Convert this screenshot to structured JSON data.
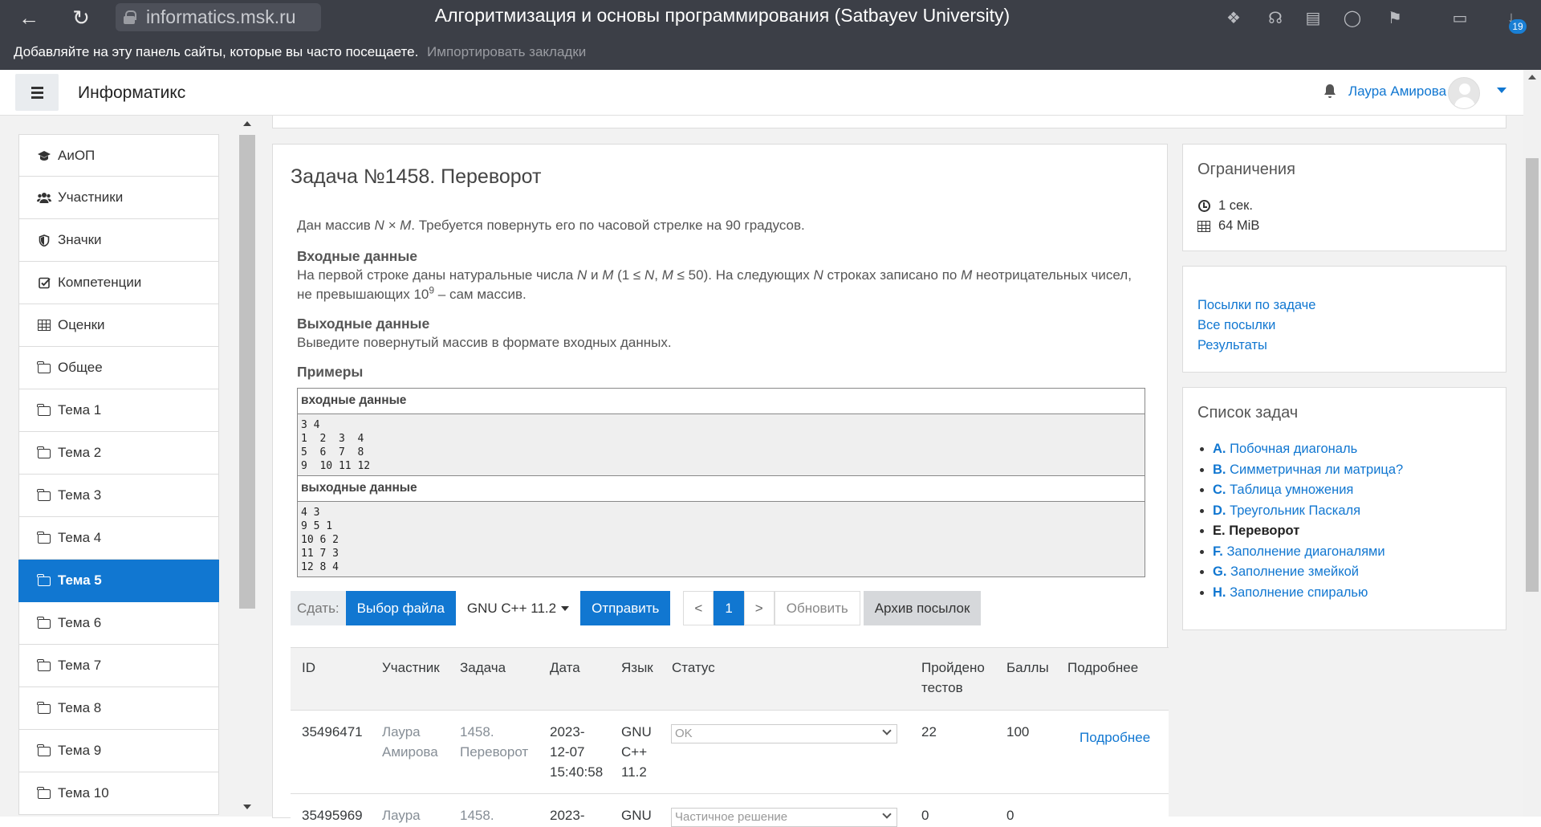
{
  "browser": {
    "url": "informatics.msk.ru",
    "page_title": "Алгоритмизация и основы программирования (Satbayev University)",
    "bookmarks_hint": "Добавляйте на эту панель сайты, которые вы часто посещаете.",
    "import_bookmarks": "Импортировать закладки",
    "downloads_badge": "19"
  },
  "navbar": {
    "brand": "Информатикс",
    "user_name": "Лаура Амирова"
  },
  "drawer": {
    "items": [
      {
        "label": "АиОП",
        "icon": "graduation-cap-icon"
      },
      {
        "label": "Участники",
        "icon": "users-icon"
      },
      {
        "label": "Значки",
        "icon": "shield-icon"
      },
      {
        "label": "Компетенции",
        "icon": "check-square-icon"
      },
      {
        "label": "Оценки",
        "icon": "table-icon"
      },
      {
        "label": "Общее",
        "icon": "folder-icon"
      },
      {
        "label": "Тема 1",
        "icon": "folder-icon"
      },
      {
        "label": "Тема 2",
        "icon": "folder-icon"
      },
      {
        "label": "Тема 3",
        "icon": "folder-icon"
      },
      {
        "label": "Тема 4",
        "icon": "folder-icon"
      },
      {
        "label": "Тема 5",
        "icon": "folder-icon",
        "active": true
      },
      {
        "label": "Тема 6",
        "icon": "folder-icon"
      },
      {
        "label": "Тема 7",
        "icon": "folder-icon"
      },
      {
        "label": "Тема 8",
        "icon": "folder-icon"
      },
      {
        "label": "Тема 9",
        "icon": "folder-icon"
      },
      {
        "label": "Тема 10",
        "icon": "folder-icon"
      }
    ]
  },
  "problem": {
    "title": "Задача №1458. Переворот",
    "statement_pre": "Дан массив ",
    "statement_math": "N × M",
    "statement_post": ". Требуется повернуть его по часовой стрелке на 90 градусов.",
    "input_heading": "Входные данные",
    "input_text_1": "На первой строке даны натуральные числа ",
    "input_n": "N",
    "input_and": " и ",
    "input_m": "M",
    "input_text_2": " (1 ≤ ",
    "input_n2": "N",
    "input_comma": ", ",
    "input_m2": "M",
    "input_text_3": " ≤ 50). На следующих ",
    "input_n3": "N",
    "input_text_4": " строках записано по ",
    "input_m3": "M",
    "input_text_5": " неотрицательных чисел, не превышающих 10",
    "input_exp": "9",
    "input_text_6": " – сам массив.",
    "output_heading": "Выходные данные",
    "output_text": "Выведите повернутый массив в формате входных данных.",
    "examples_heading": "Примеры",
    "sample_in_label": "входные данные",
    "sample_in": "3 4\n1  2  3  4\n5  6  7  8\n9  10 11 12",
    "sample_out_label": "выходные данные",
    "sample_out": "4 3\n9 5 1\n10 6 2\n11 7 3\n12 8 4"
  },
  "submit": {
    "label": "Сдать:",
    "choose_file": "Выбор файла",
    "language": "GNU C++ 11.2",
    "send": "Отправить",
    "prev": "<",
    "page": "1",
    "next": ">",
    "refresh": "Обновить",
    "archive": "Архив посылок"
  },
  "runs": {
    "headers": {
      "id": "ID",
      "user": "Участник",
      "task": "Задача",
      "date": "Дата",
      "lang": "Язык",
      "status": "Статус",
      "tests_1": "Пройдено",
      "tests_2": "тестов",
      "score": "Баллы",
      "details": "Подробнее"
    },
    "rows": [
      {
        "id": "35496471",
        "user_1": "Лаура",
        "user_2": "Амирова",
        "task_1": "1458.",
        "task_2": "Переворот",
        "date_1": "2023-",
        "date_2": "12-07",
        "date_3": "15:40:58",
        "lang_1": "GNU",
        "lang_2": "C++",
        "lang_3": "11.2",
        "status": "OK",
        "tests": "22",
        "score": "100",
        "details": "Подробнее"
      },
      {
        "id": "35495969",
        "user_1": "Лаура",
        "task_1": "1458.",
        "date_1": "2023-",
        "lang_1": "GNU",
        "status": "Частичное решение",
        "tests": "0",
        "score": "0"
      }
    ]
  },
  "limits": {
    "title": "Ограничения",
    "time": "1 сек.",
    "memory": "64 MiB"
  },
  "links": {
    "submissions": "Посылки по задаче",
    "all_submissions": "Все посылки",
    "results": "Результаты"
  },
  "tasks": {
    "title": "Список задач",
    "items": [
      {
        "letter": "A.",
        "name": "Побочная диагональ"
      },
      {
        "letter": "B.",
        "name": "Симметричная ли матрица?"
      },
      {
        "letter": "C.",
        "name": "Таблица умножения"
      },
      {
        "letter": "D.",
        "name": "Треугольник Паскаля"
      },
      {
        "letter": "E.",
        "name": "Переворот",
        "current": true
      },
      {
        "letter": "F.",
        "name": "Заполнение диагоналями"
      },
      {
        "letter": "G.",
        "name": "Заполнение змейкой"
      },
      {
        "letter": "H.",
        "name": "Заполнение спиралью"
      }
    ]
  }
}
